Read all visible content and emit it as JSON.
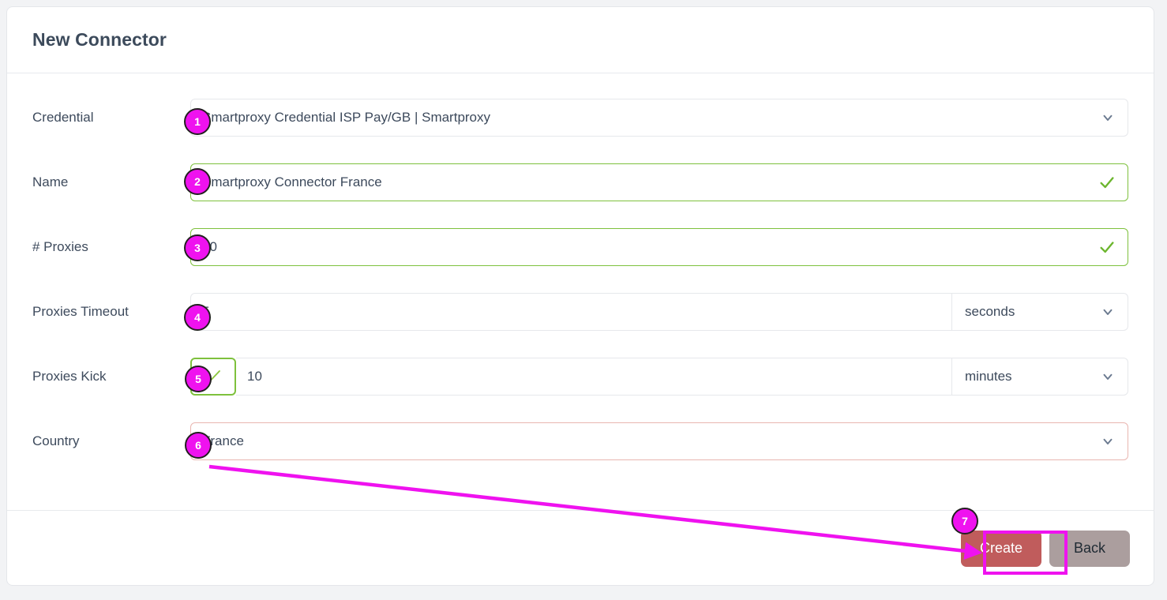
{
  "header": {
    "title": "New Connector"
  },
  "form": {
    "rows": [
      {
        "label": "Credential",
        "type": "select",
        "value": "Smartproxy Credential ISP Pay/GB | Smartproxy",
        "state": "neutral",
        "badge": "1"
      },
      {
        "label": "Name",
        "type": "text",
        "value": "Smartproxy Connector France",
        "state": "valid",
        "badge": "2"
      },
      {
        "label": "# Proxies",
        "type": "text",
        "value": "10",
        "state": "valid",
        "badge": "3"
      },
      {
        "label": "Proxies Timeout",
        "type": "number-unit",
        "value": "5",
        "unit": "seconds",
        "state": "neutral",
        "badge": "4"
      },
      {
        "label": "Proxies Kick",
        "type": "checkbox-number-unit",
        "checked": true,
        "value": "10",
        "unit": "minutes",
        "state": "valid",
        "badge": "5"
      },
      {
        "label": "Country",
        "type": "select",
        "value": "France",
        "state": "warning",
        "badge": "6"
      }
    ]
  },
  "footer": {
    "create_label": "Create",
    "back_label": "Back",
    "create_badge": "7"
  },
  "colors": {
    "accent_magenta": "#ef12ef",
    "valid_green": "#7ec13d",
    "create_red": "#c05c5c",
    "back_gray": "#ab9e9e",
    "country_border": "#e9b6b0",
    "text": "#3d4a5c"
  },
  "icons": {
    "chevron_down": "chevron-down-icon",
    "check": "check-icon"
  }
}
